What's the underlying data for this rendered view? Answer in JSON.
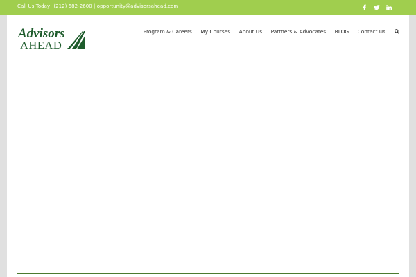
{
  "topbar": {
    "contact_prefix": "Call Us Today! ",
    "phone": "(212) 682-2600",
    "separator": " | ",
    "email": "opportunity@advisorsahead.com",
    "background": "#a0ce4e"
  },
  "social": [
    {
      "icon": "facebook-icon"
    },
    {
      "icon": "twitter-icon"
    },
    {
      "icon": "linkedin-icon"
    }
  ],
  "logo": {
    "line1": "Advisors",
    "line2": "AHEAD",
    "color": "#1e5c2c"
  },
  "nav": {
    "items": [
      {
        "label": "Program & Careers"
      },
      {
        "label": "My Courses"
      },
      {
        "label": "About Us"
      },
      {
        "label": "Partners & Advocates"
      },
      {
        "label": "BLOG"
      },
      {
        "label": "Contact Us"
      }
    ],
    "search_icon": "search-icon"
  },
  "colors": {
    "accent_green": "#a0ce4e",
    "dark_green": "#4c7a2f",
    "page_gray": "#e0e0e0"
  }
}
